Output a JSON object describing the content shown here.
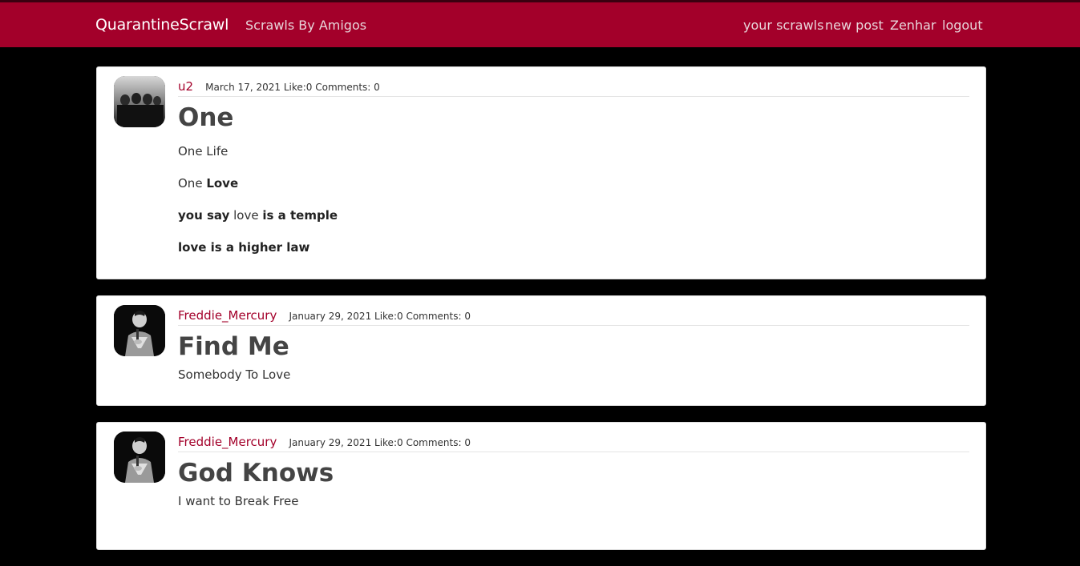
{
  "nav": {
    "brand": "QuarantineScrawl",
    "amigos": "Scrawls By Amigos",
    "your_scrawls": "your scrawls",
    "new_post": "new post",
    "user": "Zenhar",
    "logout": "logout"
  },
  "colors": {
    "accent": "#a3002a",
    "background": "#000000",
    "card": "#ffffff"
  },
  "posts": [
    {
      "author": "u2",
      "date": "March 17, 2021",
      "likes": "Like:0",
      "comments": "Comments: 0",
      "title": "One",
      "lines": {
        "l1": "One Life",
        "l2a": "One ",
        "l2b": "Love",
        "l3a": "you say",
        "l3b": " love ",
        "l3c": "is a temple",
        "l4": "love is a higher law"
      }
    },
    {
      "author": "Freddie_Mercury",
      "date": "January 29, 2021",
      "likes": "Like:0",
      "comments": "Comments: 0",
      "title": "Find Me",
      "text": "Somebody To Love"
    },
    {
      "author": "Freddie_Mercury",
      "date": "January 29, 2021",
      "likes": "Like:0",
      "comments": "Comments: 0",
      "title": "God Knows",
      "text": "I want to Break Free"
    }
  ]
}
